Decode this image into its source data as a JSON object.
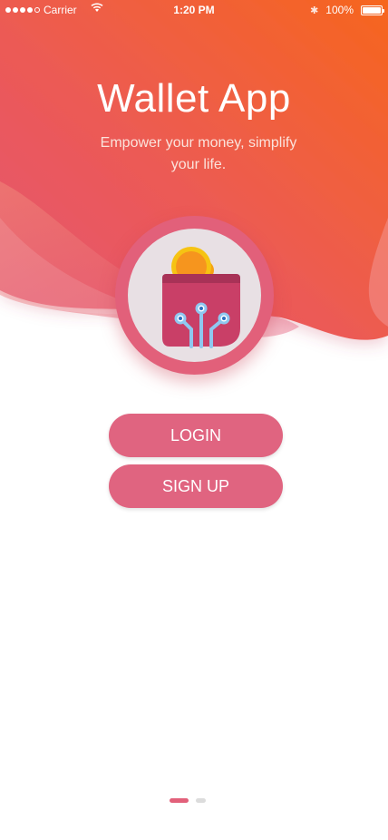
{
  "status_bar": {
    "carrier": "Carrier",
    "time": "1:20 PM",
    "battery": "100%",
    "bluetooth_glyph": "✱"
  },
  "app": {
    "title": "Wallet App",
    "tagline": "Empower your money, simplify your life."
  },
  "actions": {
    "login_label": "LOGIN",
    "signup_label": "SIGN UP"
  },
  "pager": {
    "page_count": 2,
    "active_index": 0
  },
  "icons": [
    "signal-dots-icon",
    "wifi-icon",
    "bluetooth-icon",
    "battery-icon",
    "wallet-logo-icon"
  ],
  "colors": {
    "gradient_top": "#f6661e",
    "gradient_bottom": "#e45576",
    "accent_pink": "#e06480",
    "logo_ring": "#e2607a",
    "logo_bg": "#e8e0e4",
    "wallet_body": "#c93f67",
    "coin": "#f6a313",
    "circuit": "#8fc8f0"
  }
}
